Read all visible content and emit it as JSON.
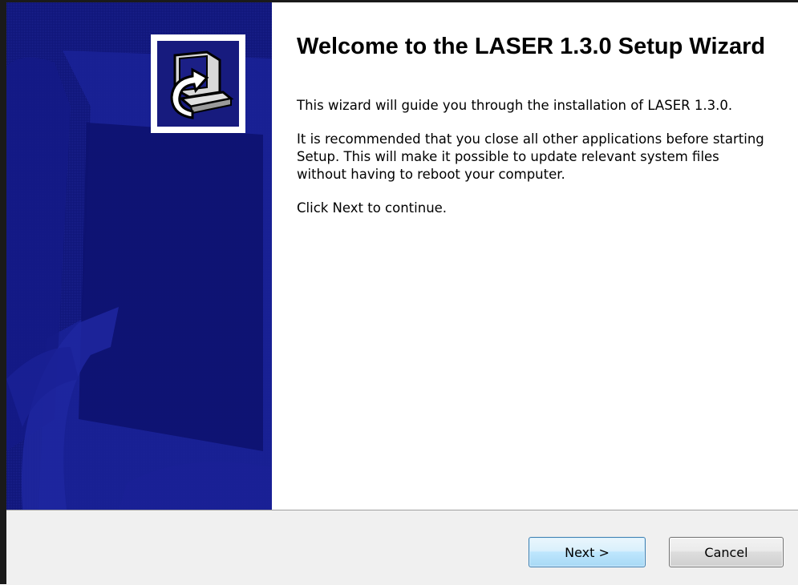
{
  "wizard": {
    "title": "Welcome to the LASER 1.3.0 Setup Wizard",
    "intro": "This wizard will guide you through the installation of LASER 1.3.0.",
    "recommendation": "It is recommended that you close all other applications before starting Setup. This will make it possible to update relevant system files without having to reboot your computer.",
    "instruction": "Click Next to continue."
  },
  "buttons": {
    "next_label": "Next >",
    "cancel_label": "Cancel"
  },
  "banner": {
    "icon": "computer-install-icon",
    "background_color": "#0f1578",
    "accent_color": "#2a35a8"
  }
}
